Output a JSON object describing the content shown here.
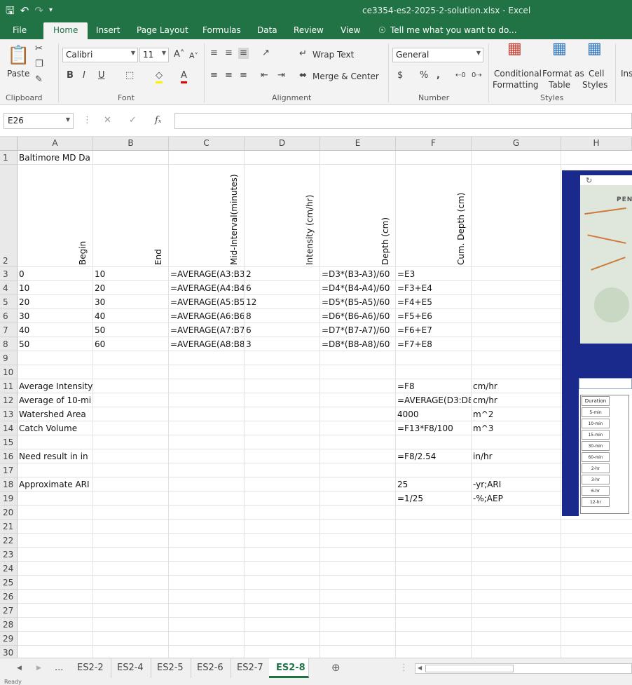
{
  "window": {
    "title": "ce3354-es2-2025-2-solution.xlsx - Excel",
    "qat": {
      "save_icon": "save-icon",
      "undo_icon": "undo-icon",
      "redo_icon": "redo-icon"
    }
  },
  "ribbon_tabs": [
    "File",
    "Home",
    "Insert",
    "Page Layout",
    "Formulas",
    "Data",
    "Review",
    "View"
  ],
  "tell_me": "Tell me what you want to do...",
  "ribbon": {
    "paste": "Paste",
    "clipboard": "Clipboard",
    "font_name": "Calibri",
    "font_size": "11",
    "font": "Font",
    "alignment": "Alignment",
    "wrap_text": "Wrap Text",
    "merge_center": "Merge & Center",
    "number_format": "General",
    "number": "Number",
    "conditional_formatting_1": "Conditional",
    "conditional_formatting_2": "Formatting",
    "format_as_table_1": "Format as",
    "format_as_table_2": "Table",
    "cell_styles_1": "Cell",
    "cell_styles_2": "Styles",
    "styles": "Styles",
    "insert_partial": "Ins",
    "bold": "B",
    "italic": "I",
    "underline": "U",
    "currency": "$",
    "percent": "%",
    "comma": ","
  },
  "formula_bar": {
    "name_box": "E26",
    "formula": ""
  },
  "columns": [
    "A",
    "B",
    "C",
    "D",
    "E",
    "F",
    "G",
    "H"
  ],
  "rows": [
    "1",
    "2",
    "3",
    "4",
    "5",
    "6",
    "7",
    "8",
    "9",
    "10",
    "11",
    "12",
    "13",
    "14",
    "15",
    "16",
    "17",
    "18",
    "19",
    "20",
    "21",
    "22",
    "23",
    "24",
    "25",
    "26",
    "27",
    "28",
    "29",
    "30"
  ],
  "cells": {
    "A1": "Baltimore MD Da",
    "A2": "Begin",
    "B2": "End",
    "C2": "Mid-Interval(minutes)",
    "D2": "Intensity (cm/hr)",
    "E2": "Depth (cm)",
    "F2": "Cum. Depth (cm)",
    "A3": "0",
    "B3": "10",
    "C3": "=AVERAGE(A3:B3",
    "D3": "2",
    "E3": "=D3*(B3-A3)/60",
    "F3": "=E3",
    "A4": "10",
    "B4": "20",
    "C4": "=AVERAGE(A4:B4",
    "D4": "6",
    "E4": "=D4*(B4-A4)/60",
    "F4": "=F3+E4",
    "A5": "20",
    "B5": "30",
    "C5": "=AVERAGE(A5:B5",
    "D5": "12",
    "E5": "=D5*(B5-A5)/60",
    "F5": "=F4+E5",
    "A6": "30",
    "B6": "40",
    "C6": "=AVERAGE(A6:B6",
    "D6": "8",
    "E6": "=D6*(B6-A6)/60",
    "F6": "=F5+E6",
    "A7": "40",
    "B7": "50",
    "C7": "=AVERAGE(A7:B7",
    "D7": "6",
    "E7": "=D7*(B7-A7)/60",
    "F7": "=F6+E7",
    "A8": "50",
    "B8": "60",
    "C8": "=AVERAGE(A8:B8",
    "D8": "3",
    "E8": "=D8*(B8-A8)/60",
    "F8": "=F7+E8",
    "A11": "Average Intensity",
    "F11": "=F8",
    "G11": "cm/hr",
    "A12": "Average of 10-mi",
    "F12": "=AVERAGE(D3:D8",
    "G12": "cm/hr",
    "A13": "Watershed Area",
    "F13": "4000",
    "G13": "m^2",
    "A14": "Catch Volume",
    "F14": "=F13*F8/100",
    "G14": "m^3",
    "A16": "Need result in in",
    "F16": "=F8/2.54",
    "G16": "in/hr",
    "A18": "Approximate ARI",
    "F18": "25",
    "G18": "-yr;ARI",
    "F19": "=1/25",
    "G19": "-%;AEP"
  },
  "image_labels": {
    "map_word": "PENN",
    "table_header": "Duration",
    "durations": [
      "5-min",
      "10-min",
      "15-min",
      "30-min",
      "60-min",
      "2-hr",
      "3-hr",
      "6-hr",
      "12-hr"
    ]
  },
  "sheet_tabs": [
    "...",
    "ES2-2",
    "ES2-4",
    "ES2-5",
    "ES2-6",
    "ES2-7",
    "ES2-8"
  ],
  "active_sheet": "ES2-8",
  "status": "Ready"
}
